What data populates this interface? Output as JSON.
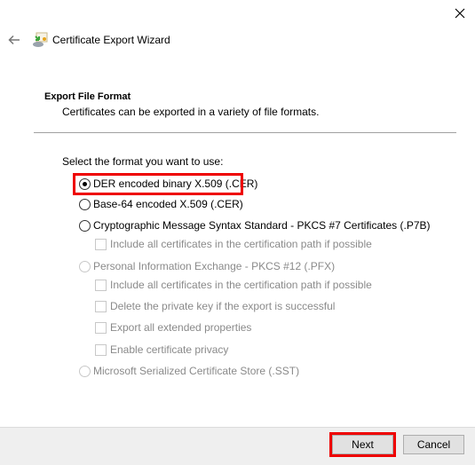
{
  "window": {
    "title": "Certificate Export Wizard"
  },
  "header": {
    "section_title": "Export File Format",
    "section_description": "Certificates can be exported in a variety of file formats."
  },
  "form": {
    "prompt": "Select the format you want to use:",
    "options": [
      {
        "label": "DER encoded binary X.509 (.CER)",
        "selected": true,
        "enabled": true,
        "highlighted": true
      },
      {
        "label": "Base-64 encoded X.509 (.CER)",
        "selected": false,
        "enabled": true
      },
      {
        "label": "Cryptographic Message Syntax Standard - PKCS #7 Certificates (.P7B)",
        "selected": false,
        "enabled": true,
        "suboptions": [
          {
            "label": "Include all certificates in the certification path if possible",
            "checked": false,
            "enabled": false
          }
        ]
      },
      {
        "label": "Personal Information Exchange - PKCS #12 (.PFX)",
        "selected": false,
        "enabled": false,
        "suboptions": [
          {
            "label": "Include all certificates in the certification path if possible",
            "checked": false,
            "enabled": false
          },
          {
            "label": "Delete the private key if the export is successful",
            "checked": false,
            "enabled": false
          },
          {
            "label": "Export all extended properties",
            "checked": false,
            "enabled": false
          },
          {
            "label": "Enable certificate privacy",
            "checked": false,
            "enabled": false
          }
        ]
      },
      {
        "label": "Microsoft Serialized Certificate Store (.SST)",
        "selected": false,
        "enabled": false
      }
    ]
  },
  "footer": {
    "next_label": "Next",
    "cancel_label": "Cancel",
    "next_highlighted": true
  },
  "colors": {
    "highlight": "#ee0000",
    "footer_bg": "#efefef",
    "disabled_text": "#8a8a8a"
  },
  "icons": {
    "close": "close-icon",
    "back": "back-arrow-icon",
    "app": "certificate-icon"
  }
}
